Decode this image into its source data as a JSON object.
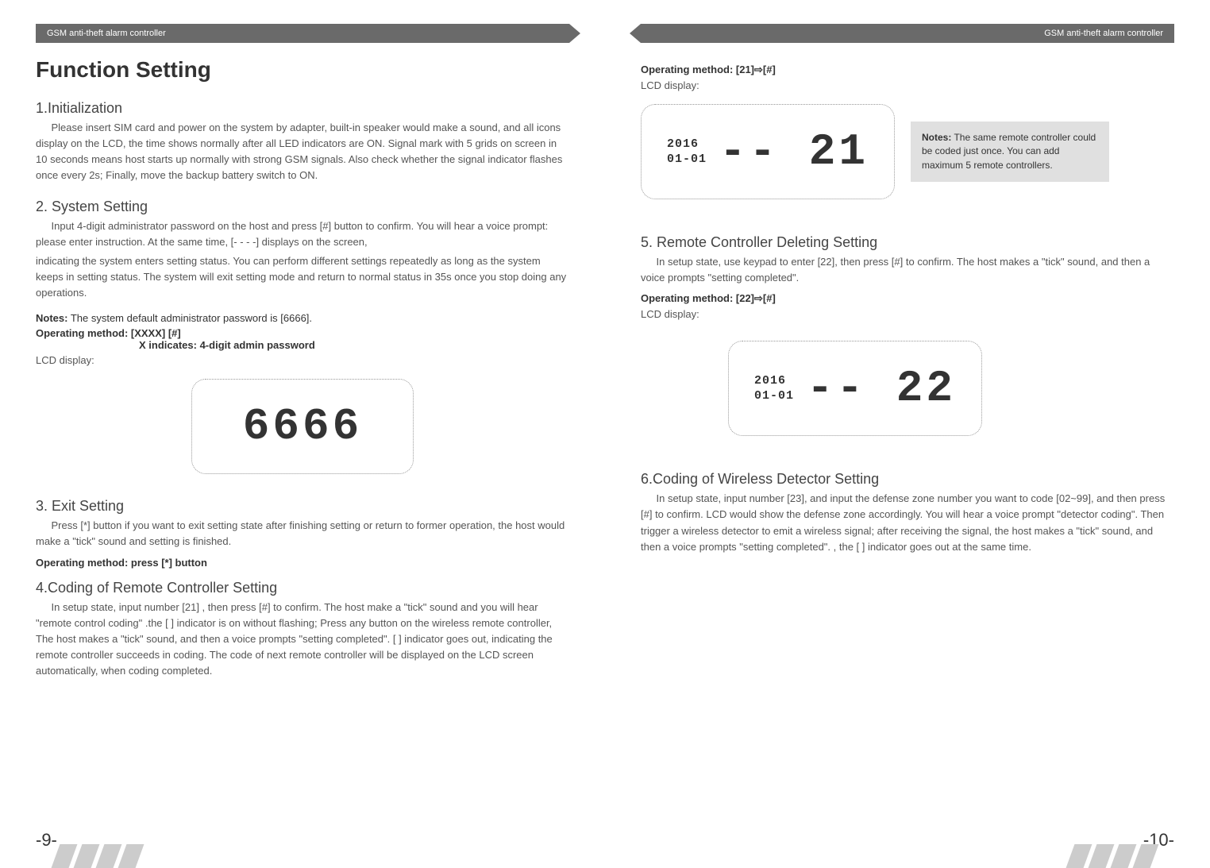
{
  "header": {
    "left": "GSM anti-theft alarm controller",
    "right": "GSM anti-theft alarm controller"
  },
  "pageLeft": {
    "title": "Function Setting",
    "s1": {
      "heading": "1.Initialization",
      "body": "Please insert SIM card and power on the system by adapter, built-in speaker would make a sound, and all icons display on the LCD, the time shows normally after all LED indicators are ON. Signal mark with 5 grids on screen in 10 seconds means host starts up normally with strong GSM signals. Also check whether the signal indicator flashes once every 2s; Finally, move the backup battery switch to ON."
    },
    "s2": {
      "heading": "2. System Setting",
      "body1": "Input 4-digit administrator password on the  host  and press [#] button to confirm. You will hear a voice prompt: please enter instruction. At the same time,  [- - - -]  displays on the screen,",
      "body2": "indicating the system enters setting status. You can perform different settings repeatedly as long as the system keeps in setting status. The system will exit setting mode and return to normal status  in  35s  once  you  stop  doing  any  operations.",
      "notesLabel": "Notes:",
      "notesText": " The system default administrator password is [6666].",
      "op": "Operating method: [XXXX] [#]",
      "opSub": "X indicates: 4-digit admin password",
      "lcdLabel": "LCD display:",
      "lcdValue": "6666"
    },
    "s3": {
      "heading": "3. Exit Setting",
      "body": "Press [*] button if you want to exit setting state after finishing setting or return to former operation, the host would make a \"tick\" sound and setting is finished.",
      "op": "Operating method: press  [*] button"
    },
    "s4": {
      "heading": "4.Coding of Remote Controller Setting",
      "body": "In setup state, input number [21] , then press [#] to confirm. The host make a  \"tick\" sound and you will hear \"remote control coding\" .the [   ] indicator is on without flashing; Press any button on the wireless remote controller, The host makes a \"tick\" sound, and then a voice prompts \"setting completed\". [   ] indicator goes out, indicating the remote controller succeeds in coding. The code of next remote controller will be displayed on the LCD screen automatically, when coding completed."
    },
    "pageNum": "-9-"
  },
  "pageRight": {
    "top": {
      "op_pre": "Operating method: [21]",
      "op_post": "[#]",
      "lcdLabel": "LCD display:",
      "lcdYear": "2016",
      "lcdDate": "01-01",
      "lcdValue": "-- 21",
      "noteLabel": "Notes:",
      "noteText": " The same remote controller could be coded just once. You can add maximum 5 remote controllers."
    },
    "s5": {
      "heading": "5. Remote Controller Deleting Setting",
      "body": "In setup state, use keypad to enter [22], then press [#] to confirm. The host makes a \"tick\" sound, and then a voice prompts \"setting completed\".",
      "op_pre": "Operating method: [22]",
      "op_post": "[#]",
      "lcdLabel": "LCD display:",
      "lcdYear": "2016",
      "lcdDate": "01-01",
      "lcdValue": "-- 22"
    },
    "s6": {
      "heading": "6.Coding of Wireless Detector Setting",
      "body": "In setup state, input number [23], and input the defense zone number you want to code [02~99], and then press [#] to confirm. LCD would show the defense zone accordingly. You will hear a voice prompt \"detector coding\". Then trigger a wireless detector to emit a wireless signal; after receiving the signal, the host makes a \"tick\" sound, and then a voice prompts \"setting completed\". , the [    ] indicator goes out at the same time."
    },
    "pageNum": "-10-"
  }
}
